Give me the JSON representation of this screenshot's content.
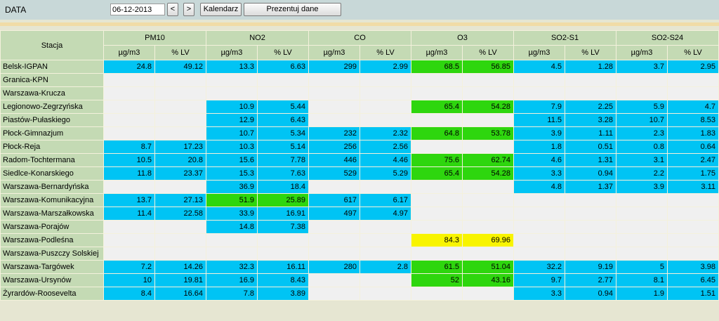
{
  "toolbar": {
    "date_label": "DATA",
    "date_value": "06-12-2013",
    "prev_label": "<",
    "next_label": ">",
    "calendar_label": "Kalendarz",
    "show_label": "Prezentuj dane"
  },
  "colors": {
    "none": "#f0f0f0",
    "blue": "#00c4f4",
    "green": "#2ed60e",
    "yellow": "#f8f400",
    "header": "#c4dab4",
    "toolbar": "#c8d8d8"
  },
  "table": {
    "station_header": "Stacja",
    "pollutants": [
      "PM10",
      "NO2",
      "CO",
      "O3",
      "SO2-S1",
      "SO2-S24"
    ],
    "units": [
      "µg/m3",
      "% LV"
    ],
    "rows": [
      {
        "station": "Belsk-IGPAN",
        "cells": [
          [
            "24.8",
            "blue"
          ],
          [
            "49.12",
            "blue"
          ],
          [
            "13.3",
            "blue"
          ],
          [
            "6.63",
            "blue"
          ],
          [
            "299",
            "blue"
          ],
          [
            "2.99",
            "blue"
          ],
          [
            "68.5",
            "green"
          ],
          [
            "56.85",
            "green"
          ],
          [
            "4.5",
            "blue"
          ],
          [
            "1.28",
            "blue"
          ],
          [
            "3.7",
            "blue"
          ],
          [
            "2.95",
            "blue"
          ]
        ]
      },
      {
        "station": "Granica-KPN",
        "cells": [
          [
            "",
            "none"
          ],
          [
            "",
            "none"
          ],
          [
            "",
            "none"
          ],
          [
            "",
            "none"
          ],
          [
            "",
            "none"
          ],
          [
            "",
            "none"
          ],
          [
            "",
            "none"
          ],
          [
            "",
            "none"
          ],
          [
            "",
            "none"
          ],
          [
            "",
            "none"
          ],
          [
            "",
            "none"
          ],
          [
            "",
            "none"
          ]
        ]
      },
      {
        "station": "Warszawa-Krucza",
        "cells": [
          [
            "",
            "none"
          ],
          [
            "",
            "none"
          ],
          [
            "",
            "none"
          ],
          [
            "",
            "none"
          ],
          [
            "",
            "none"
          ],
          [
            "",
            "none"
          ],
          [
            "",
            "none"
          ],
          [
            "",
            "none"
          ],
          [
            "",
            "none"
          ],
          [
            "",
            "none"
          ],
          [
            "",
            "none"
          ],
          [
            "",
            "none"
          ]
        ]
      },
      {
        "station": "Legionowo-Zegrzyńska",
        "cells": [
          [
            "",
            "none"
          ],
          [
            "",
            "none"
          ],
          [
            "10.9",
            "blue"
          ],
          [
            "5.44",
            "blue"
          ],
          [
            "",
            "none"
          ],
          [
            "",
            "none"
          ],
          [
            "65.4",
            "green"
          ],
          [
            "54.28",
            "green"
          ],
          [
            "7.9",
            "blue"
          ],
          [
            "2.25",
            "blue"
          ],
          [
            "5.9",
            "blue"
          ],
          [
            "4.7",
            "blue"
          ]
        ]
      },
      {
        "station": "Piastów-Pułaskiego",
        "cells": [
          [
            "",
            "none"
          ],
          [
            "",
            "none"
          ],
          [
            "12.9",
            "blue"
          ],
          [
            "6.43",
            "blue"
          ],
          [
            "",
            "none"
          ],
          [
            "",
            "none"
          ],
          [
            "",
            "none"
          ],
          [
            "",
            "none"
          ],
          [
            "11.5",
            "blue"
          ],
          [
            "3.28",
            "blue"
          ],
          [
            "10.7",
            "blue"
          ],
          [
            "8.53",
            "blue"
          ]
        ]
      },
      {
        "station": "Płock-Gimnazjum",
        "cells": [
          [
            "",
            "none"
          ],
          [
            "",
            "none"
          ],
          [
            "10.7",
            "blue"
          ],
          [
            "5.34",
            "blue"
          ],
          [
            "232",
            "blue"
          ],
          [
            "2.32",
            "blue"
          ],
          [
            "64.8",
            "green"
          ],
          [
            "53.78",
            "green"
          ],
          [
            "3.9",
            "blue"
          ],
          [
            "1.11",
            "blue"
          ],
          [
            "2.3",
            "blue"
          ],
          [
            "1.83",
            "blue"
          ]
        ]
      },
      {
        "station": "Płock-Reja",
        "cells": [
          [
            "8.7",
            "blue"
          ],
          [
            "17.23",
            "blue"
          ],
          [
            "10.3",
            "blue"
          ],
          [
            "5.14",
            "blue"
          ],
          [
            "256",
            "blue"
          ],
          [
            "2.56",
            "blue"
          ],
          [
            "",
            "none"
          ],
          [
            "",
            "none"
          ],
          [
            "1.8",
            "blue"
          ],
          [
            "0.51",
            "blue"
          ],
          [
            "0.8",
            "blue"
          ],
          [
            "0.64",
            "blue"
          ]
        ]
      },
      {
        "station": "Radom-Tochtermana",
        "cells": [
          [
            "10.5",
            "blue"
          ],
          [
            "20.8",
            "blue"
          ],
          [
            "15.6",
            "blue"
          ],
          [
            "7.78",
            "blue"
          ],
          [
            "446",
            "blue"
          ],
          [
            "4.46",
            "blue"
          ],
          [
            "75.6",
            "green"
          ],
          [
            "62.74",
            "green"
          ],
          [
            "4.6",
            "blue"
          ],
          [
            "1.31",
            "blue"
          ],
          [
            "3.1",
            "blue"
          ],
          [
            "2.47",
            "blue"
          ]
        ]
      },
      {
        "station": "Siedlce-Konarskiego",
        "cells": [
          [
            "11.8",
            "blue"
          ],
          [
            "23.37",
            "blue"
          ],
          [
            "15.3",
            "blue"
          ],
          [
            "7.63",
            "blue"
          ],
          [
            "529",
            "blue"
          ],
          [
            "5.29",
            "blue"
          ],
          [
            "65.4",
            "green"
          ],
          [
            "54.28",
            "green"
          ],
          [
            "3.3",
            "blue"
          ],
          [
            "0.94",
            "blue"
          ],
          [
            "2.2",
            "blue"
          ],
          [
            "1.75",
            "blue"
          ]
        ]
      },
      {
        "station": "Warszawa-Bernardyńska",
        "cells": [
          [
            "",
            "none"
          ],
          [
            "",
            "none"
          ],
          [
            "36.9",
            "blue"
          ],
          [
            "18.4",
            "blue"
          ],
          [
            "",
            "none"
          ],
          [
            "",
            "none"
          ],
          [
            "",
            "none"
          ],
          [
            "",
            "none"
          ],
          [
            "4.8",
            "blue"
          ],
          [
            "1.37",
            "blue"
          ],
          [
            "3.9",
            "blue"
          ],
          [
            "3.11",
            "blue"
          ]
        ]
      },
      {
        "station": "Warszawa-Komunikacyjna",
        "cells": [
          [
            "13.7",
            "blue"
          ],
          [
            "27.13",
            "blue"
          ],
          [
            "51.9",
            "green"
          ],
          [
            "25.89",
            "green"
          ],
          [
            "617",
            "blue"
          ],
          [
            "6.17",
            "blue"
          ],
          [
            "",
            "none"
          ],
          [
            "",
            "none"
          ],
          [
            "",
            "none"
          ],
          [
            "",
            "none"
          ],
          [
            "",
            "none"
          ],
          [
            "",
            "none"
          ]
        ]
      },
      {
        "station": "Warszawa-Marszałkowska",
        "cells": [
          [
            "11.4",
            "blue"
          ],
          [
            "22.58",
            "blue"
          ],
          [
            "33.9",
            "blue"
          ],
          [
            "16.91",
            "blue"
          ],
          [
            "497",
            "blue"
          ],
          [
            "4.97",
            "blue"
          ],
          [
            "",
            "none"
          ],
          [
            "",
            "none"
          ],
          [
            "",
            "none"
          ],
          [
            "",
            "none"
          ],
          [
            "",
            "none"
          ],
          [
            "",
            "none"
          ]
        ]
      },
      {
        "station": "Warszawa-Porajów",
        "cells": [
          [
            "",
            "none"
          ],
          [
            "",
            "none"
          ],
          [
            "14.8",
            "blue"
          ],
          [
            "7.38",
            "blue"
          ],
          [
            "",
            "none"
          ],
          [
            "",
            "none"
          ],
          [
            "",
            "none"
          ],
          [
            "",
            "none"
          ],
          [
            "",
            "none"
          ],
          [
            "",
            "none"
          ],
          [
            "",
            "none"
          ],
          [
            "",
            "none"
          ]
        ]
      },
      {
        "station": "Warszawa-Podleśna",
        "cells": [
          [
            "",
            "none"
          ],
          [
            "",
            "none"
          ],
          [
            "",
            "none"
          ],
          [
            "",
            "none"
          ],
          [
            "",
            "none"
          ],
          [
            "",
            "none"
          ],
          [
            "84.3",
            "yellow"
          ],
          [
            "69.96",
            "yellow"
          ],
          [
            "",
            "none"
          ],
          [
            "",
            "none"
          ],
          [
            "",
            "none"
          ],
          [
            "",
            "none"
          ]
        ]
      },
      {
        "station": "Warszawa-Puszczy Solskiej",
        "cells": [
          [
            "",
            "none"
          ],
          [
            "",
            "none"
          ],
          [
            "",
            "none"
          ],
          [
            "",
            "none"
          ],
          [
            "",
            "none"
          ],
          [
            "",
            "none"
          ],
          [
            "",
            "none"
          ],
          [
            "",
            "none"
          ],
          [
            "",
            "none"
          ],
          [
            "",
            "none"
          ],
          [
            "",
            "none"
          ],
          [
            "",
            "none"
          ]
        ]
      },
      {
        "station": "Warszawa-Targówek",
        "cells": [
          [
            "7.2",
            "blue"
          ],
          [
            "14.26",
            "blue"
          ],
          [
            "32.3",
            "blue"
          ],
          [
            "16.11",
            "blue"
          ],
          [
            "280",
            "blue"
          ],
          [
            "2.8",
            "blue"
          ],
          [
            "61.5",
            "green"
          ],
          [
            "51.04",
            "green"
          ],
          [
            "32.2",
            "blue"
          ],
          [
            "9.19",
            "blue"
          ],
          [
            "5",
            "blue"
          ],
          [
            "3.98",
            "blue"
          ]
        ]
      },
      {
        "station": "Warszawa-Ursynów",
        "cells": [
          [
            "10",
            "blue"
          ],
          [
            "19.81",
            "blue"
          ],
          [
            "16.9",
            "blue"
          ],
          [
            "8.43",
            "blue"
          ],
          [
            "",
            "none"
          ],
          [
            "",
            "none"
          ],
          [
            "52",
            "green"
          ],
          [
            "43.16",
            "green"
          ],
          [
            "9.7",
            "blue"
          ],
          [
            "2.77",
            "blue"
          ],
          [
            "8.1",
            "blue"
          ],
          [
            "6.45",
            "blue"
          ]
        ]
      },
      {
        "station": "Żyrardów-Roosevelta",
        "cells": [
          [
            "8.4",
            "blue"
          ],
          [
            "16.64",
            "blue"
          ],
          [
            "7.8",
            "blue"
          ],
          [
            "3.89",
            "blue"
          ],
          [
            "",
            "none"
          ],
          [
            "",
            "none"
          ],
          [
            "",
            "none"
          ],
          [
            "",
            "none"
          ],
          [
            "3.3",
            "blue"
          ],
          [
            "0.94",
            "blue"
          ],
          [
            "1.9",
            "blue"
          ],
          [
            "1.51",
            "blue"
          ]
        ]
      }
    ]
  }
}
